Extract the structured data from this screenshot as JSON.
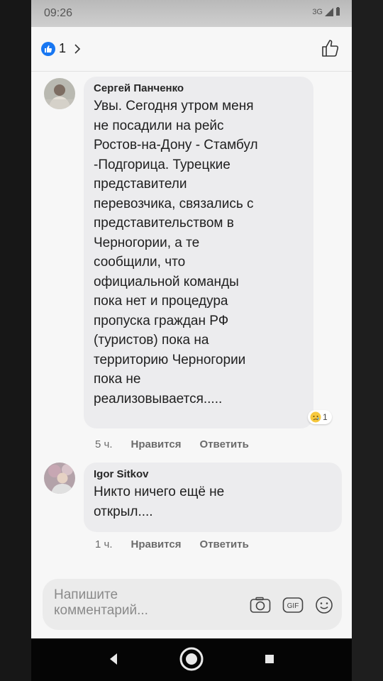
{
  "status_bar": {
    "time": "09:26",
    "network": "3G"
  },
  "post": {
    "reaction_count": "1"
  },
  "comments": [
    {
      "author": "Сергей Панченко",
      "text": "Увы. Сегодня утром меня\nне посадили на рейс\nРостов-на-Дону - Стамбул\n-Подгорица. Турецкие\nпредставители\nперевозчика, связались с\nпредставительством в\nЧерногории, а те\nсообщили, что\nофициальной команды\nпока нет и процедура\nпропуска граждан РФ\n(туристов) пока на\nтерриторию Черногории\nпока не\nреализовывается.....",
      "time": "5 ч.",
      "like_label": "Нравится",
      "reply_label": "Ответить",
      "reaction_count": "1",
      "reaction_icon": "sad-emoji-icon"
    },
    {
      "author": "Igor Sitkov",
      "text": "Никто ничего ещё не\nоткрыл....",
      "time": "1 ч.",
      "like_label": "Нравится",
      "reply_label": "Ответить"
    }
  ],
  "composer": {
    "placeholder": "Напишите\nкомментарий...",
    "icons": [
      "camera-icon",
      "gif-icon",
      "emoji-icon"
    ]
  },
  "colors": {
    "like_blue": "#1877f2",
    "bubble": "#ececee",
    "panel": "#f7f7f7"
  }
}
